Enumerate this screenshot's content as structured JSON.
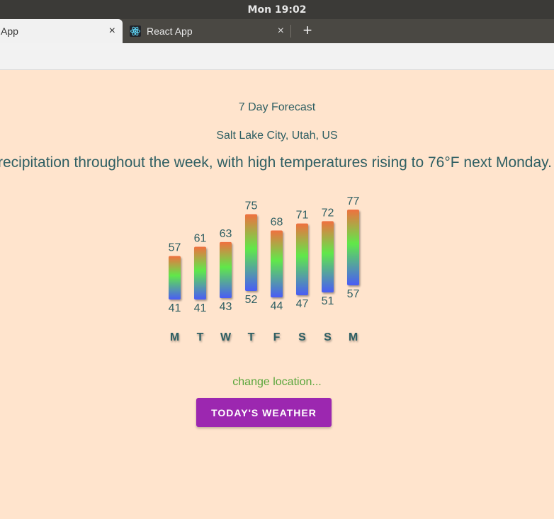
{
  "system": {
    "clock": "Mon 19:02"
  },
  "tabs": [
    {
      "title": "React App",
      "visible_title": "t App",
      "close": "×"
    },
    {
      "title": "React App",
      "close": "×"
    }
  ],
  "newtab": {
    "label": "+"
  },
  "page": {
    "heading": "7 Day Forecast",
    "location": "Salt Lake City, Utah, US",
    "summary": "recipitation throughout the week, with high temperatures rising to 76°F next Monday.",
    "change_location": "change location...",
    "todays_weather_button": "TODAY'S WEATHER"
  },
  "colors": {
    "background": "#ffe4cd",
    "text": "#2f5f63",
    "button": "#9c27b0",
    "link": "#5aa63c",
    "bar_hot": "#f07040",
    "bar_mid": "#60e84a",
    "bar_cold": "#4a5cf5"
  },
  "chart_data": {
    "type": "bar",
    "categories": [
      "M",
      "T",
      "W",
      "T",
      "F",
      "S",
      "S",
      "M"
    ],
    "series": [
      {
        "values": [
          57,
          61,
          63,
          75,
          68,
          71,
          72,
          77
        ]
      },
      {
        "values": [
          41,
          41,
          43,
          52,
          44,
          47,
          51,
          57
        ]
      }
    ]
  }
}
